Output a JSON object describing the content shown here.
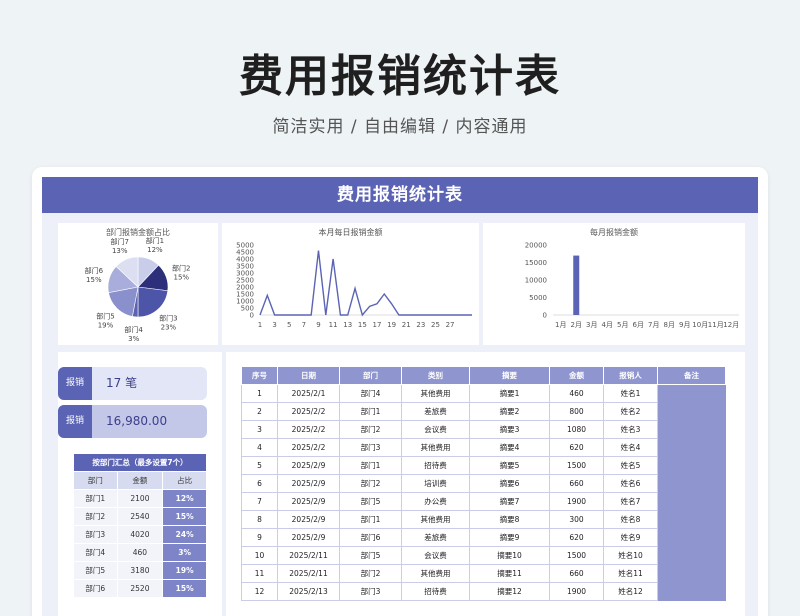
{
  "hero": {
    "title": "费用报销统计表",
    "subtitle": "简洁实用 / 自由编辑 / 内容通用"
  },
  "sheet": {
    "banner": "费用报销统计表"
  },
  "pie_chart": {
    "title": "部门报销金额占比",
    "slices": [
      {
        "label": "部门1",
        "pct": "12%",
        "value": 12,
        "color": "#c9cdea"
      },
      {
        "label": "部门2",
        "pct": "15%",
        "value": 15,
        "color": "#2d2f7a"
      },
      {
        "label": "部门3",
        "pct": "23%",
        "value": 23,
        "color": "#4d55a8"
      },
      {
        "label": "部门4",
        "pct": "3%",
        "value": 3,
        "color": "#5c63b0"
      },
      {
        "label": "部门5",
        "pct": "19%",
        "value": 19,
        "color": "#8a90cc"
      },
      {
        "label": "部门6",
        "pct": "15%",
        "value": 15,
        "color": "#a8addb"
      },
      {
        "label": "部门7",
        "pct": "13%",
        "value": 13,
        "color": "#dcdff2"
      }
    ]
  },
  "chart_data": [
    {
      "type": "line",
      "title": "本月每日报销金额",
      "x": [
        1,
        2,
        3,
        4,
        5,
        6,
        7,
        8,
        9,
        10,
        11,
        12,
        13,
        14,
        15,
        16,
        17,
        18,
        19,
        20,
        21,
        22,
        23,
        24,
        25,
        26,
        27,
        28,
        29,
        30
      ],
      "values": [
        0,
        1400,
        0,
        0,
        0,
        0,
        0,
        0,
        4600,
        0,
        4000,
        0,
        0,
        1900,
        0,
        620,
        800,
        1500,
        800,
        0,
        0,
        0,
        0,
        0,
        0,
        0,
        0,
        0,
        0,
        0
      ],
      "xticks": [
        1,
        3,
        5,
        7,
        9,
        11,
        13,
        15,
        17,
        19,
        21,
        23,
        25,
        27
      ],
      "yticks": [
        0,
        500,
        1000,
        1500,
        2000,
        2500,
        3000,
        3500,
        4000,
        4500,
        5000
      ],
      "ylim": [
        0,
        5000
      ],
      "color": "#5b64b4"
    },
    {
      "type": "bar",
      "title": "每月报销金额",
      "categories": [
        "1月",
        "2月",
        "3月",
        "4月",
        "5月",
        "6月",
        "7月",
        "8月",
        "9月",
        "10月",
        "11月",
        "12月"
      ],
      "values": [
        0,
        16980,
        0,
        0,
        0,
        0,
        0,
        0,
        0,
        0,
        0,
        0
      ],
      "yticks": [
        0,
        5000,
        10000,
        15000,
        20000
      ],
      "ylim": [
        0,
        20000
      ],
      "color": "#5b64b4"
    }
  ],
  "stats": {
    "count_tag": "报销",
    "count_value": "17 笔",
    "amount_tag": "报销",
    "amount_value": "16,980.00"
  },
  "summary": {
    "caption": "按部门汇总（最多设置7个）",
    "headers": [
      "部门",
      "金额",
      "占比"
    ],
    "rows": [
      [
        "部门1",
        "2100",
        "12%"
      ],
      [
        "部门2",
        "2540",
        "15%"
      ],
      [
        "部门3",
        "4020",
        "24%"
      ],
      [
        "部门4",
        "460",
        "3%"
      ],
      [
        "部门5",
        "3180",
        "19%"
      ],
      [
        "部门6",
        "2520",
        "15%"
      ]
    ]
  },
  "detail": {
    "headers": [
      "序号",
      "日期",
      "部门",
      "类别",
      "摘要",
      "金额",
      "报销人",
      "备注"
    ],
    "rows": [
      [
        "1",
        "2025/2/1",
        "部门4",
        "其他费用",
        "摘要1",
        "460",
        "姓名1"
      ],
      [
        "2",
        "2025/2/2",
        "部门1",
        "差旅费",
        "摘要2",
        "800",
        "姓名2"
      ],
      [
        "3",
        "2025/2/2",
        "部门2",
        "会议费",
        "摘要3",
        "1080",
        "姓名3"
      ],
      [
        "4",
        "2025/2/2",
        "部门3",
        "其他费用",
        "摘要4",
        "620",
        "姓名4"
      ],
      [
        "5",
        "2025/2/9",
        "部门1",
        "招待费",
        "摘要5",
        "1500",
        "姓名5"
      ],
      [
        "6",
        "2025/2/9",
        "部门2",
        "培训费",
        "摘要6",
        "660",
        "姓名6"
      ],
      [
        "7",
        "2025/2/9",
        "部门5",
        "办公费",
        "摘要7",
        "1900",
        "姓名7"
      ],
      [
        "8",
        "2025/2/9",
        "部门1",
        "其他费用",
        "摘要8",
        "300",
        "姓名8"
      ],
      [
        "9",
        "2025/2/9",
        "部门6",
        "差旅费",
        "摘要9",
        "620",
        "姓名9"
      ],
      [
        "10",
        "2025/2/11",
        "部门5",
        "会议费",
        "摘要10",
        "1500",
        "姓名10"
      ],
      [
        "11",
        "2025/2/11",
        "部门2",
        "其他费用",
        "摘要11",
        "660",
        "姓名11"
      ],
      [
        "12",
        "2025/2/13",
        "部门3",
        "招待费",
        "摘要12",
        "1900",
        "姓名12"
      ]
    ]
  }
}
